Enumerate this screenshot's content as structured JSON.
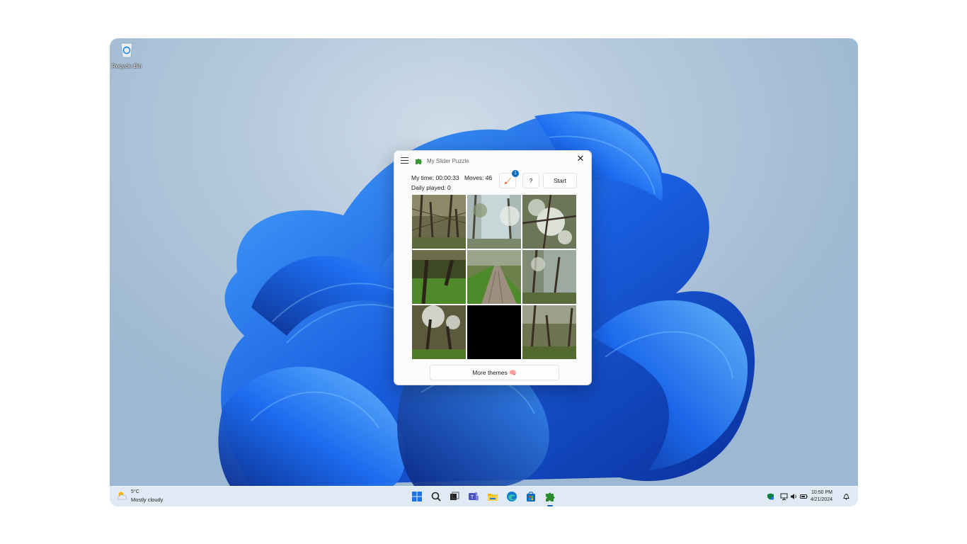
{
  "desktop": {
    "recycle_bin_label": "Recycle Bin"
  },
  "window": {
    "title": "My Slider Puzzle",
    "close_label": "✕",
    "my_time_label": "My time: 00:00:33",
    "moves_label": "Moves: 46",
    "daily_played_label": "Daily played: 0",
    "theme_badge": "1",
    "help_label": "?",
    "start_label": "Start",
    "more_themes_label": "More themes 🧠",
    "board": {
      "rows": 3,
      "cols": 3,
      "empty_tile": "row 3, column 2",
      "theme": "forest path with blossoming trees"
    }
  },
  "taskbar": {
    "weather_temp": "5°C",
    "weather_condition": "Mostly cloudy",
    "time": "10:50 PM",
    "date": "4/21/2024",
    "icons": [
      "start-icon",
      "search-icon",
      "task-view-icon",
      "teams-icon",
      "file-explorer-icon",
      "edge-icon",
      "store-icon",
      "puzzle-app-icon"
    ],
    "tray_icons": [
      "defender-icon",
      "network-icon",
      "volume-icon",
      "battery-icon",
      "notification-bell-icon"
    ]
  },
  "colors": {
    "accent": "#0f6cbd",
    "wallpaper_bloom": "#1a5fe0",
    "wallpaper_bg": "#b5c9dc"
  }
}
